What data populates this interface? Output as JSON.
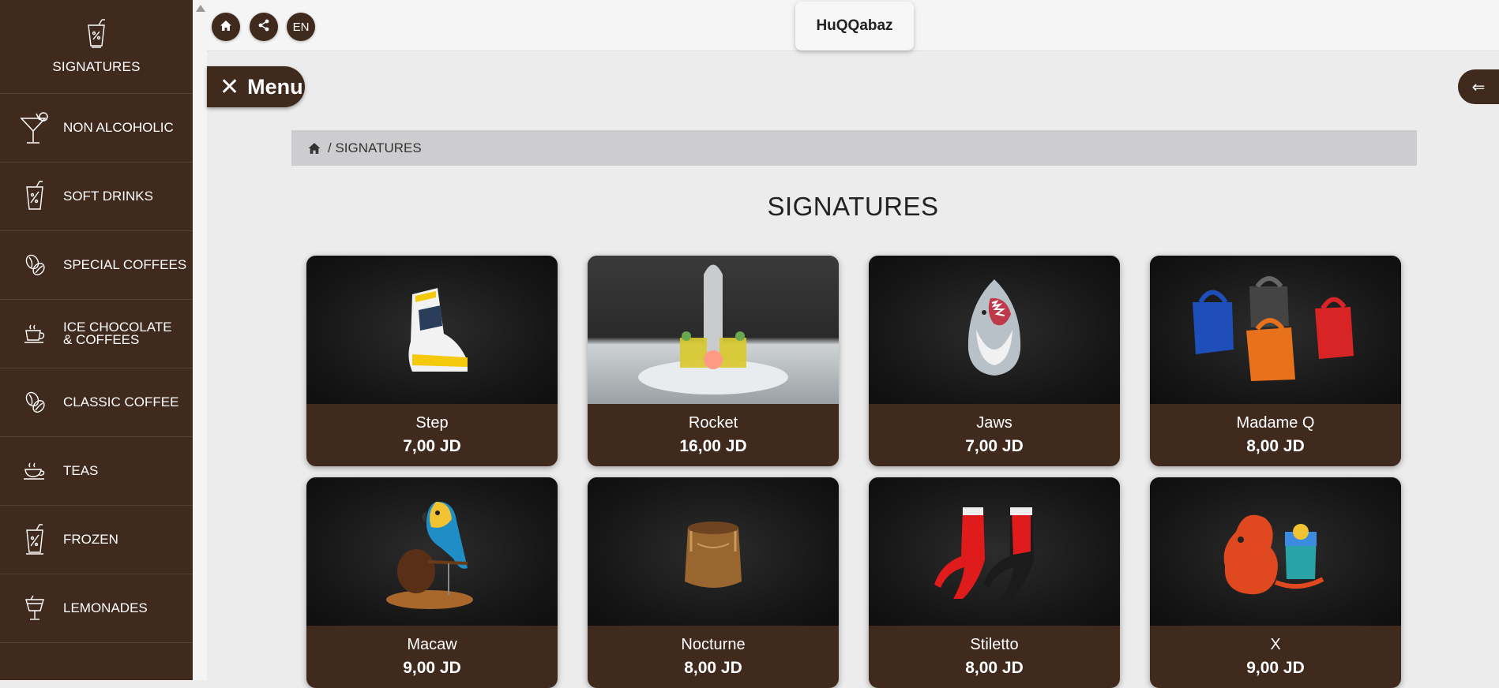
{
  "sidebar": {
    "header": {
      "icon": "drink-glass-icon",
      "label": "SIGNATURES"
    },
    "items": [
      {
        "label": "NON ALCOHOLIC",
        "icon": "cocktail-icon"
      },
      {
        "label": "SOFT DRINKS",
        "icon": "soda-glass-icon"
      },
      {
        "label": "SPECIAL COFFEES",
        "icon": "coffee-beans-icon"
      },
      {
        "label": "ICE CHOCOLATE\n& COFFEES",
        "icon": "coffee-cup-icon"
      },
      {
        "label": "CLASSIC COFFEE",
        "icon": "coffee-beans-icon"
      },
      {
        "label": "TEAS",
        "icon": "tea-cup-icon"
      },
      {
        "label": "FROZEN",
        "icon": "frozen-drink-icon"
      },
      {
        "label": "LEMONADES",
        "icon": "lemonade-glass-icon"
      }
    ]
  },
  "topbar": {
    "language": "EN",
    "logo": "HuQQabaz"
  },
  "menu_button": {
    "label": "Menu"
  },
  "breadcrumb": {
    "path": "/ SIGNATURES"
  },
  "page_title": "SIGNATURES",
  "products": [
    {
      "name": "Step",
      "price": "7,00 JD"
    },
    {
      "name": "Rocket",
      "price": "16,00 JD"
    },
    {
      "name": "Jaws",
      "price": "7,00 JD"
    },
    {
      "name": "Madame Q",
      "price": "8,00 JD"
    },
    {
      "name": "Macaw",
      "price": "9,00 JD"
    },
    {
      "name": "Nocturne",
      "price": "8,00 JD"
    },
    {
      "name": "Stiletto",
      "price": "8,00 JD"
    },
    {
      "name": "X",
      "price": "9,00 JD"
    }
  ],
  "colors": {
    "brand": "#3f2a1d",
    "background": "#ececec",
    "breadcrumb": "#cdcdcf"
  }
}
